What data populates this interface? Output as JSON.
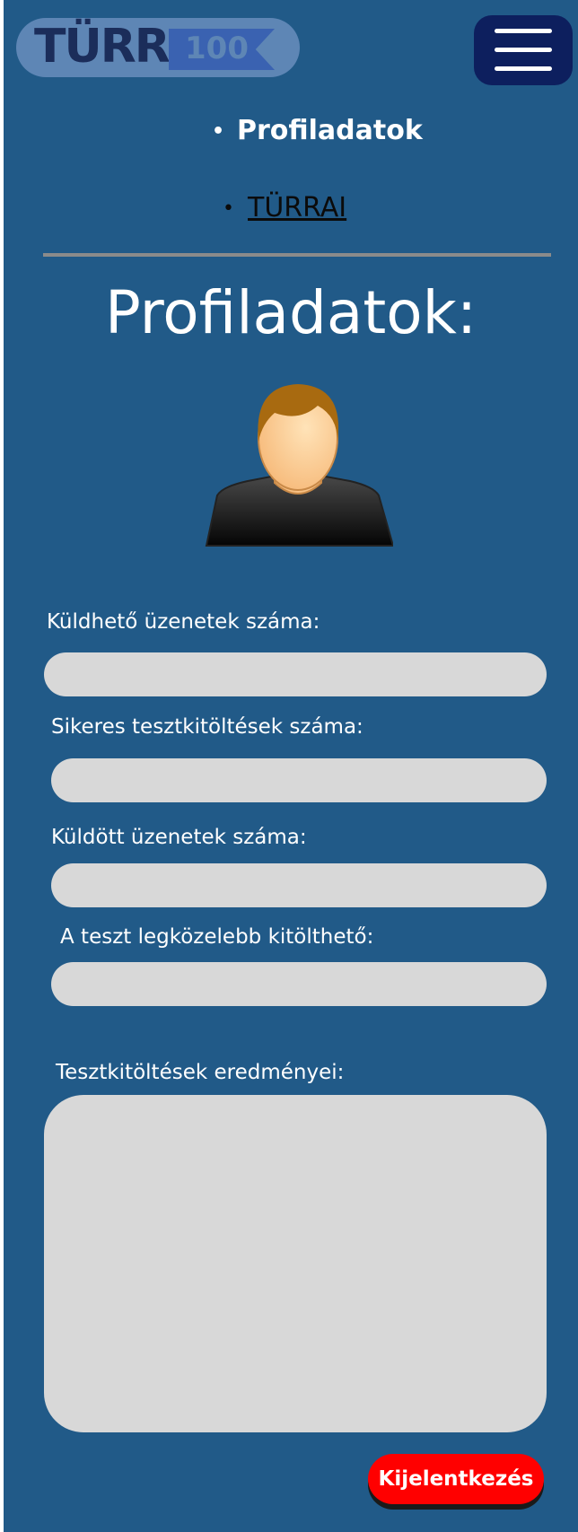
{
  "header": {
    "logo_text": "TÜRR",
    "logo_number": "100",
    "menu_icon": "hamburger-menu-icon"
  },
  "nav": {
    "items": [
      {
        "label": "Profiladatok",
        "active": true
      },
      {
        "label": "TÜRRAI",
        "active": false
      }
    ]
  },
  "main": {
    "title": "Profiladatok:",
    "avatar_icon": "user-avatar-icon",
    "fields": [
      {
        "label": "Küldhető üzenetek száma:",
        "value": ""
      },
      {
        "label": "Sikeres tesztkitöltések száma:",
        "value": ""
      },
      {
        "label": "Küldött üzenetek száma:",
        "value": ""
      },
      {
        "label": "A teszt legközelebb kitölthető:",
        "value": ""
      }
    ],
    "results_label": "Tesztkitöltések eredményei:",
    "results_value": ""
  },
  "logout_label": "Kijelentkezés",
  "colors": {
    "background": "#215a88",
    "field": "#d8d8d8",
    "logout": "#ff0000",
    "menu_button": "#0d1f5e"
  }
}
